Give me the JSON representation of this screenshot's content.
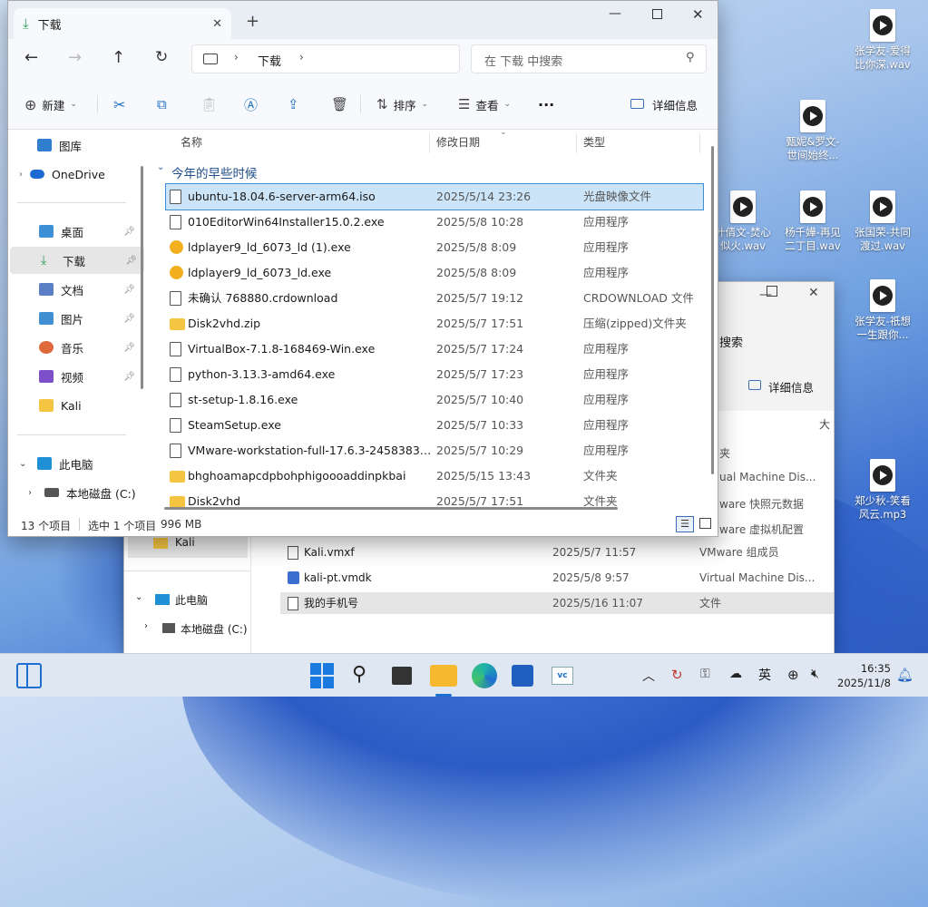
{
  "desktop": {
    "icons": [
      {
        "label": "张学友-爱得\n比你深.wav"
      },
      {
        "label": "甄妮&罗文-\n世间始终..."
      },
      {
        "label": "叶倩文-焚心\n似火.wav"
      },
      {
        "label": "杨千嬅-再见\n二丁目.wav"
      },
      {
        "label": "张国荣-共同\n渡过.wav"
      },
      {
        "label": "张学友-祇想\n一生跟你..."
      },
      {
        "label": "郑少秋-笑看\n风云.mp3"
      }
    ]
  },
  "window": {
    "tab_title": "下载",
    "new_tab": "+",
    "controls": {
      "minimize": "—",
      "maximize": "☐",
      "close": "✕"
    },
    "address": {
      "crumb": "下载",
      "search_placeholder": "在 下载 中搜索"
    },
    "toolbar": {
      "new_label": "新建",
      "sort_label": "排序",
      "view_label": "查看",
      "more_label": "···",
      "details_label": "详细信息"
    },
    "nav": {
      "top_items": [
        {
          "label": "图库"
        },
        {
          "label": "OneDrive"
        }
      ],
      "quick": [
        {
          "label": "桌面",
          "color": "#3d8fd6"
        },
        {
          "label": "下载",
          "color": "#2a9d5c"
        },
        {
          "label": "文档",
          "color": "#5b7fc4"
        },
        {
          "label": "图片",
          "color": "#3f8fd2"
        },
        {
          "label": "音乐",
          "color": "#e0683d"
        },
        {
          "label": "视频",
          "color": "#7d4fc9"
        },
        {
          "label": "Kali",
          "color": "#f5c542"
        }
      ],
      "pc_label": "此电脑",
      "disk_label": "本地磁盘 (C:)"
    },
    "columns": {
      "name": "名称",
      "date": "修改日期",
      "type": "类型"
    },
    "group_label": "今年的早些时候",
    "files": [
      {
        "name": "ubuntu-18.04.6-server-arm64.iso",
        "date": "2025/5/14 23:26",
        "type": "光盘映像文件",
        "icon": "file",
        "selected": true
      },
      {
        "name": "010EditorWin64Installer15.0.2.exe",
        "date": "2025/5/8 10:28",
        "type": "应用程序",
        "icon": "file"
      },
      {
        "name": "ldplayer9_ld_6073_ld (1).exe",
        "date": "2025/5/8 8:09",
        "type": "应用程序",
        "icon": "ld"
      },
      {
        "name": "ldplayer9_ld_6073_ld.exe",
        "date": "2025/5/8 8:09",
        "type": "应用程序",
        "icon": "ld"
      },
      {
        "name": "未确认 768880.crdownload",
        "date": "2025/5/7 19:12",
        "type": "CRDOWNLOAD 文件",
        "icon": "file"
      },
      {
        "name": "Disk2vhd.zip",
        "date": "2025/5/7 17:51",
        "type": "压缩(zipped)文件夹",
        "icon": "fold"
      },
      {
        "name": "VirtualBox-7.1.8-168469-Win.exe",
        "date": "2025/5/7 17:24",
        "type": "应用程序",
        "icon": "file"
      },
      {
        "name": "python-3.13.3-amd64.exe",
        "date": "2025/5/7 17:23",
        "type": "应用程序",
        "icon": "file"
      },
      {
        "name": "st-setup-1.8.16.exe",
        "date": "2025/5/7 10:40",
        "type": "应用程序",
        "icon": "file"
      },
      {
        "name": "SteamSetup.exe",
        "date": "2025/5/7 10:33",
        "type": "应用程序",
        "icon": "file"
      },
      {
        "name": "VMware-workstation-full-17.6.3-24583834....",
        "date": "2025/5/7 10:29",
        "type": "应用程序",
        "icon": "file"
      },
      {
        "name": "bhghoamapcdpbohphigoooaddinpkbai",
        "date": "2025/5/15 13:43",
        "type": "文件夹",
        "icon": "fold"
      },
      {
        "name": "Disk2vhd",
        "date": "2025/5/7 17:51",
        "type": "文件夹",
        "icon": "fold"
      }
    ],
    "status": {
      "count": "13 个项目",
      "selected": "选中 1 个项目",
      "size": "996 MB"
    }
  },
  "bg_window": {
    "search_fragment": "搜索",
    "details_label": "详细信息",
    "col_fragment": "大",
    "side": {
      "kali": "Kali",
      "pc": "此电脑",
      "disk": "本地磁盘 (C:)"
    },
    "types_partial": [
      "夹",
      "ual Machine Dis...",
      "ware 快照元数据",
      "ware 虚拟机配置"
    ],
    "rows": [
      {
        "name": "Kali.vmxf",
        "date": "2025/5/7 11:57",
        "type": "VMware 组成员"
      },
      {
        "name": "kali-pt.vmdk",
        "date": "2025/5/8 9:57",
        "type": "Virtual Machine Dis..."
      },
      {
        "name": "我的手机号",
        "date": "2025/5/16 11:07",
        "type": "文件"
      }
    ]
  },
  "taskbar": {
    "ime": "英",
    "time": "16:35",
    "date": "2025/11/8"
  }
}
